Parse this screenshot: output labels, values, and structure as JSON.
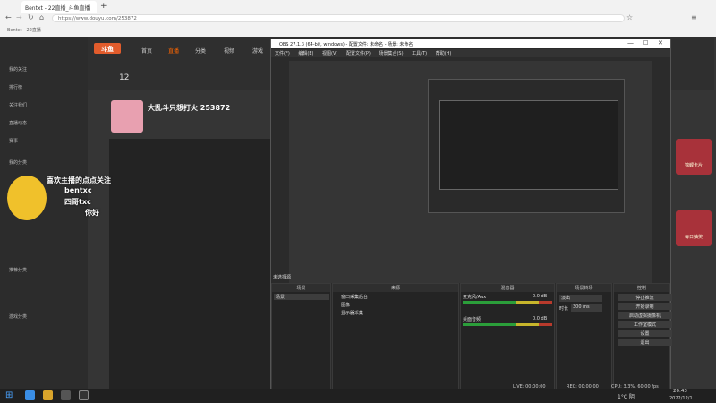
{
  "browser": {
    "tab_title": "Bentxt - 22直播_斗鱼直播",
    "url": "https://www.douyu.com/253872",
    "bookmark": "Bentxt - 22直播"
  },
  "site": {
    "logo": "斗鱼",
    "nav": [
      "首页",
      "直播",
      "分类",
      "视频",
      "游戏"
    ],
    "room_title": "大乱斗只想打火 253872",
    "sidebar": [
      "我的关注",
      "排行榜",
      "关注我们",
      "直播动态",
      "赛事",
      "我的分类",
      "推荐分类",
      "游戏分类"
    ],
    "overlay": {
      "line1": "喜欢主播的点点关注",
      "line2": "bentxc",
      "line3": "四哥txc",
      "line4": "你好",
      "count": "12"
    },
    "ad_labels": [
      "锦鲤卡片",
      "每日抽奖"
    ]
  },
  "obs": {
    "title": "OBS 27.1.3 (64-bit, windows) - 配置文件: 未命名 - 场景: 未命名",
    "menu": [
      "文件(F)",
      "编辑(E)",
      "视图(V)",
      "配置文件(P)",
      "场景集合(S)",
      "工具(T)",
      "帮助(H)"
    ],
    "no_source": "未选择源",
    "docks": {
      "scenes": "场景",
      "sources": "来源",
      "mixer": "混音器",
      "transitions": "场景转场",
      "controls": "控制"
    },
    "scene_item": "场景",
    "sources": [
      "窗口采集后台",
      "图像",
      "显示器采集"
    ],
    "mixer": [
      {
        "name": "麦克风/Aux",
        "db": "0.0 dB"
      },
      {
        "name": "桌面音频",
        "db": "0.0 dB"
      }
    ],
    "transition": {
      "type": "淡出",
      "duration_label": "时长",
      "duration": "300 ms"
    },
    "controls": [
      "停止推流",
      "开始录制",
      "启动虚拟摄像机",
      "工作室模式",
      "设置",
      "退出"
    ],
    "status": {
      "live": "LIVE: 00:00:00",
      "rec": "REC: 00:00:00",
      "cpu": "CPU: 3.3%, 60.00 fps"
    }
  },
  "taskbar": {
    "weather": "1°C 阴",
    "time": "20:43",
    "date": "2022/12/1"
  }
}
